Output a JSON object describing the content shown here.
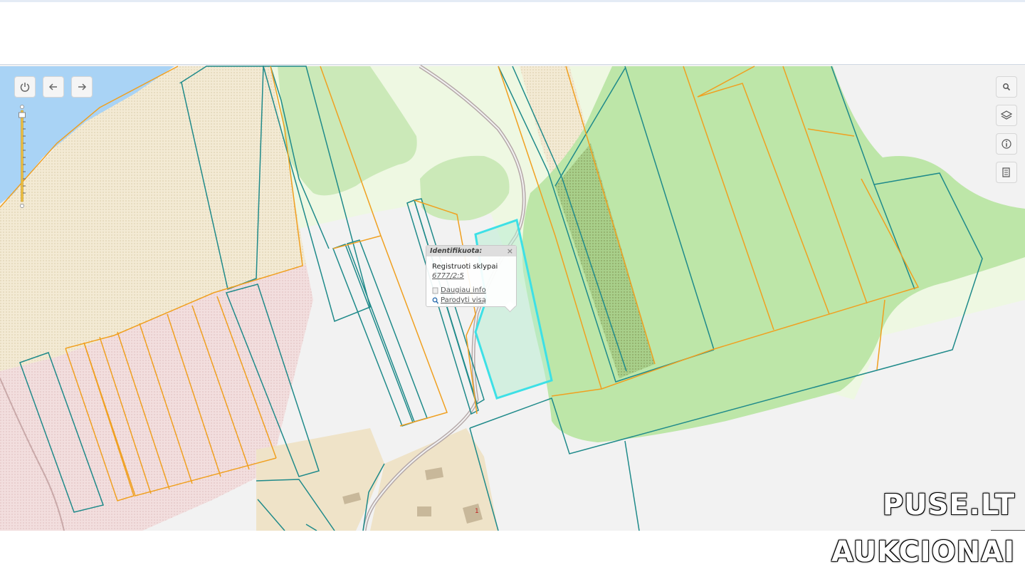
{
  "popup": {
    "header": "Identifikuota:",
    "close_label": "×",
    "layer": "Registruoti sklypai",
    "parcel": "6777/2:5",
    "more_info": "Daugiau info",
    "show_all": "Parodyti visą"
  },
  "map_controls": {
    "left": [
      "power-icon",
      "arrow-left-icon",
      "arrow-right-icon"
    ],
    "right": [
      "search-icon",
      "layers-icon",
      "info-icon",
      "document-icon"
    ]
  },
  "building_label": "1",
  "watermark": {
    "line1": "PUSE.LT",
    "line2": "AUKCIONAI"
  },
  "colors": {
    "water": "#a9d3f5",
    "forest": "#b9e3a3",
    "light_green": "#eef8e2",
    "farmland": "#f4ecd8",
    "urban": "#efe3c8",
    "pink": "#f3e0e0",
    "parcel_teal": "#1f8a8a",
    "parcel_orange": "#f0a020",
    "selection": "#3de0e6"
  }
}
